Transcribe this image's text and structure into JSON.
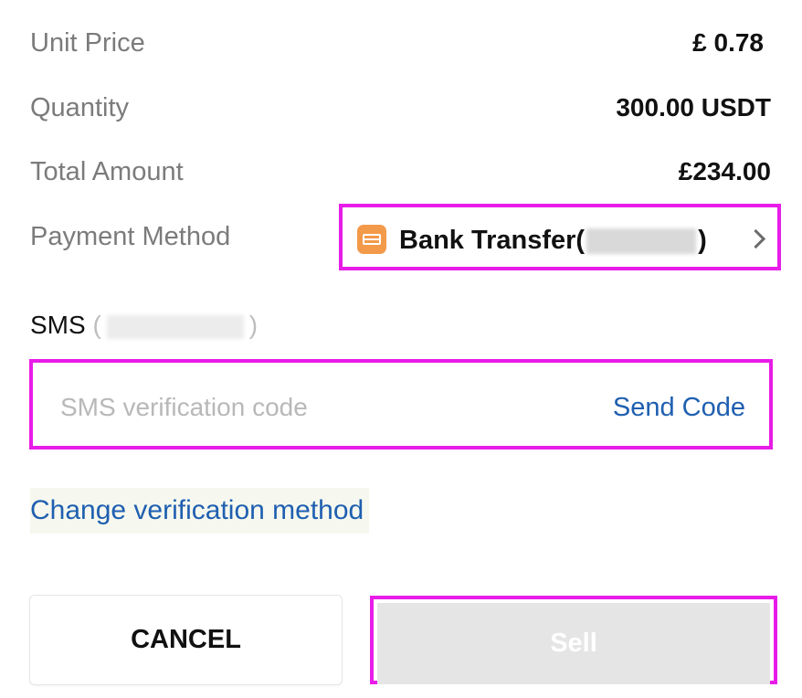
{
  "order": {
    "rows": [
      {
        "label": "Unit Price",
        "value": "£ 0.78"
      },
      {
        "label": "Quantity",
        "value": "300.00 USDT"
      },
      {
        "label": "Total Amount",
        "value": "£234.00"
      }
    ],
    "payment_label": "Payment Method",
    "payment_method_prefix": "Bank Transfer(",
    "payment_method_suffix": ")"
  },
  "sms": {
    "label": "SMS",
    "paren_open": "(",
    "paren_close": ")",
    "placeholder": "SMS verification code",
    "send_code": "Send Code"
  },
  "change_method": "Change verification method",
  "buttons": {
    "cancel": "CANCEL",
    "sell": "Sell"
  },
  "colors": {
    "accent": "#1f5fb0",
    "highlight": "#e81ce8",
    "bank_icon": "#f39a4a",
    "disabled": "#e5e5e5"
  },
  "icons": {
    "bank": "bank-card-icon",
    "chevron": "chevron-right-icon"
  }
}
